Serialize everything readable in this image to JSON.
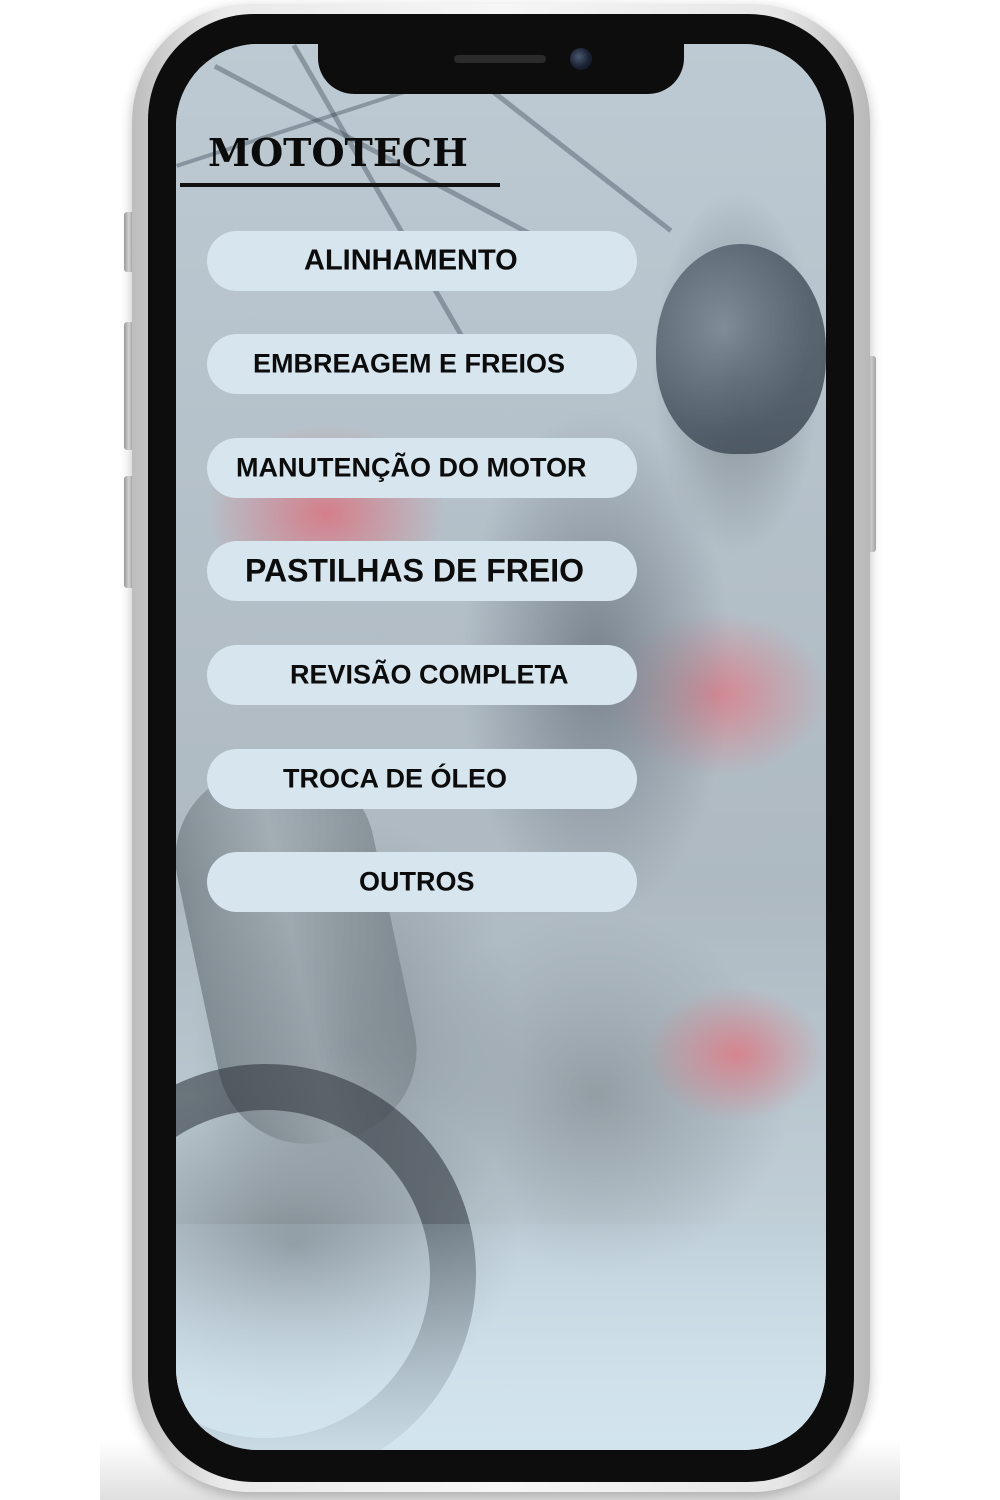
{
  "app": {
    "brand": "MOTOTECH"
  },
  "menu": {
    "items": [
      {
        "label": "ALINHAMENTO"
      },
      {
        "label": "EMBREAGEM E FREIOS"
      },
      {
        "label": "MANUTENÇÃO DO MOTOR"
      },
      {
        "label": "PASTILHAS DE FREIO"
      },
      {
        "label": "REVISÃO COMPLETA"
      },
      {
        "label": "TROCA DE ÓLEO"
      },
      {
        "label": "OUTROS"
      }
    ]
  },
  "colors": {
    "button_bg": "#d7e5ee",
    "text": "#0c0c0c",
    "frame": "#0d0d0d"
  }
}
